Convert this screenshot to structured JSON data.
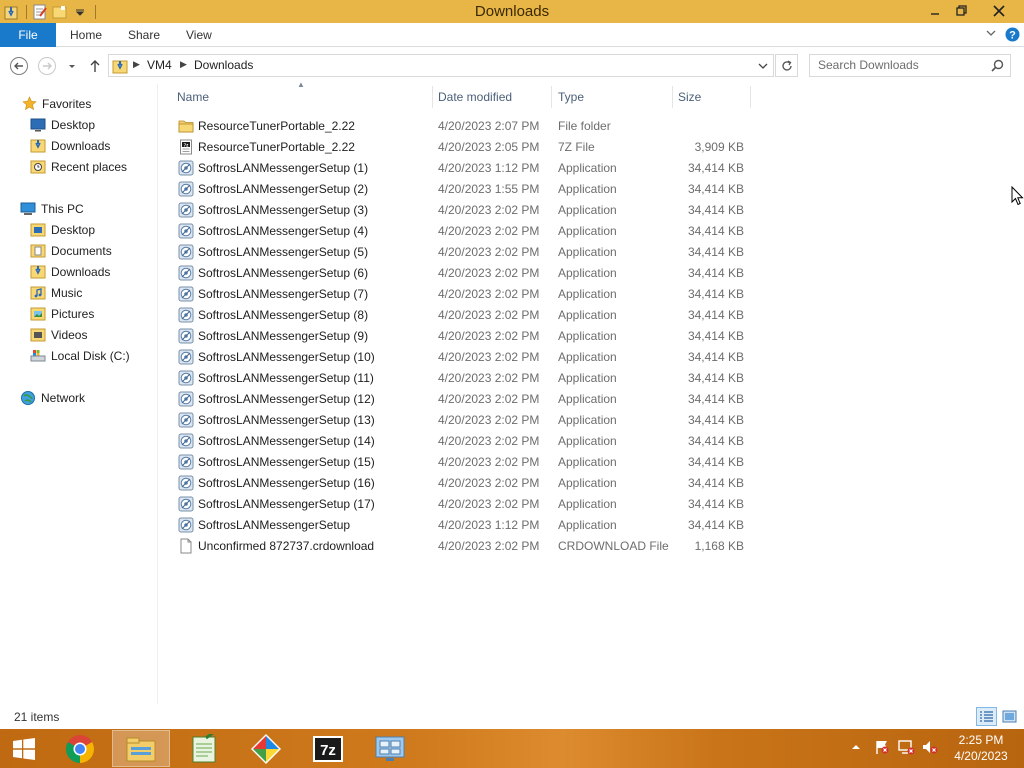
{
  "window": {
    "title": "Downloads"
  },
  "ribbon": {
    "file": "File",
    "tabs": [
      "Home",
      "Share",
      "View"
    ]
  },
  "address": {
    "crumbs": [
      "VM4",
      "Downloads"
    ]
  },
  "search": {
    "placeholder": "Search Downloads"
  },
  "nav": {
    "favorites": "Favorites",
    "favorites_items": [
      "Desktop",
      "Downloads",
      "Recent places"
    ],
    "this_pc": "This PC",
    "this_pc_items": [
      "Desktop",
      "Documents",
      "Downloads",
      "Music",
      "Pictures",
      "Videos",
      "Local Disk (C:)"
    ],
    "network": "Network"
  },
  "columns": {
    "name": "Name",
    "date": "Date modified",
    "type": "Type",
    "size": "Size"
  },
  "files": [
    {
      "name": "ResourceTunerPortable_2.22",
      "date": "4/20/2023 2:07 PM",
      "type": "File folder",
      "size": "",
      "icon": "folder-icon"
    },
    {
      "name": "ResourceTunerPortable_2.22",
      "date": "4/20/2023 2:05 PM",
      "type": "7Z File",
      "size": "3,909 KB",
      "icon": "archive-icon"
    },
    {
      "name": "SoftrosLANMessengerSetup (1)",
      "date": "4/20/2023 1:12 PM",
      "type": "Application",
      "size": "34,414 KB",
      "icon": "installer-icon"
    },
    {
      "name": "SoftrosLANMessengerSetup (2)",
      "date": "4/20/2023 1:55 PM",
      "type": "Application",
      "size": "34,414 KB",
      "icon": "installer-icon"
    },
    {
      "name": "SoftrosLANMessengerSetup (3)",
      "date": "4/20/2023 2:02 PM",
      "type": "Application",
      "size": "34,414 KB",
      "icon": "installer-icon"
    },
    {
      "name": "SoftrosLANMessengerSetup (4)",
      "date": "4/20/2023 2:02 PM",
      "type": "Application",
      "size": "34,414 KB",
      "icon": "installer-icon"
    },
    {
      "name": "SoftrosLANMessengerSetup (5)",
      "date": "4/20/2023 2:02 PM",
      "type": "Application",
      "size": "34,414 KB",
      "icon": "installer-icon"
    },
    {
      "name": "SoftrosLANMessengerSetup (6)",
      "date": "4/20/2023 2:02 PM",
      "type": "Application",
      "size": "34,414 KB",
      "icon": "installer-icon"
    },
    {
      "name": "SoftrosLANMessengerSetup (7)",
      "date": "4/20/2023 2:02 PM",
      "type": "Application",
      "size": "34,414 KB",
      "icon": "installer-icon"
    },
    {
      "name": "SoftrosLANMessengerSetup (8)",
      "date": "4/20/2023 2:02 PM",
      "type": "Application",
      "size": "34,414 KB",
      "icon": "installer-icon"
    },
    {
      "name": "SoftrosLANMessengerSetup (9)",
      "date": "4/20/2023 2:02 PM",
      "type": "Application",
      "size": "34,414 KB",
      "icon": "installer-icon"
    },
    {
      "name": "SoftrosLANMessengerSetup (10)",
      "date": "4/20/2023 2:02 PM",
      "type": "Application",
      "size": "34,414 KB",
      "icon": "installer-icon"
    },
    {
      "name": "SoftrosLANMessengerSetup (11)",
      "date": "4/20/2023 2:02 PM",
      "type": "Application",
      "size": "34,414 KB",
      "icon": "installer-icon"
    },
    {
      "name": "SoftrosLANMessengerSetup (12)",
      "date": "4/20/2023 2:02 PM",
      "type": "Application",
      "size": "34,414 KB",
      "icon": "installer-icon"
    },
    {
      "name": "SoftrosLANMessengerSetup (13)",
      "date": "4/20/2023 2:02 PM",
      "type": "Application",
      "size": "34,414 KB",
      "icon": "installer-icon"
    },
    {
      "name": "SoftrosLANMessengerSetup (14)",
      "date": "4/20/2023 2:02 PM",
      "type": "Application",
      "size": "34,414 KB",
      "icon": "installer-icon"
    },
    {
      "name": "SoftrosLANMessengerSetup (15)",
      "date": "4/20/2023 2:02 PM",
      "type": "Application",
      "size": "34,414 KB",
      "icon": "installer-icon"
    },
    {
      "name": "SoftrosLANMessengerSetup (16)",
      "date": "4/20/2023 2:02 PM",
      "type": "Application",
      "size": "34,414 KB",
      "icon": "installer-icon"
    },
    {
      "name": "SoftrosLANMessengerSetup (17)",
      "date": "4/20/2023 2:02 PM",
      "type": "Application",
      "size": "34,414 KB",
      "icon": "installer-icon"
    },
    {
      "name": "SoftrosLANMessengerSetup",
      "date": "4/20/2023 1:12 PM",
      "type": "Application",
      "size": "34,414 KB",
      "icon": "installer-icon"
    },
    {
      "name": "Unconfirmed 872737.crdownload",
      "date": "4/20/2023 2:02 PM",
      "type": "CRDOWNLOAD File",
      "size": "1,168 KB",
      "icon": "blank-file-icon"
    }
  ],
  "status": {
    "count": "21 items"
  },
  "taskbar": {
    "time": "2:25 PM",
    "date": "4/20/2023",
    "apps": [
      "chrome-icon",
      "file-explorer-icon",
      "notepad-icon",
      "paint-app-icon",
      "7zip-icon",
      "network-app-icon"
    ]
  },
  "colors": {
    "titlebar": "#e8b547",
    "file_tab": "#1979ca",
    "taskbar": "#c97418"
  }
}
